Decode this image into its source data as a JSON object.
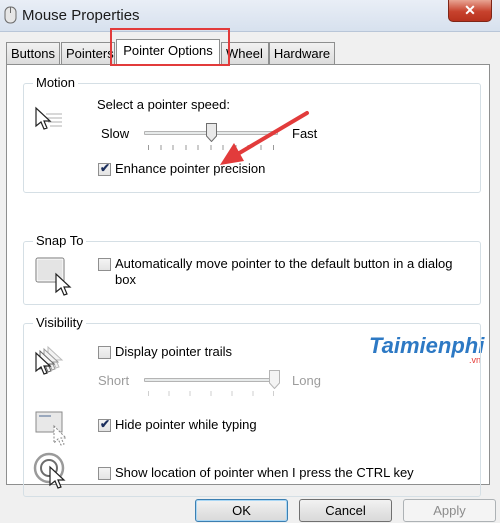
{
  "window": {
    "title": "Mouse Properties",
    "close_label": "✕"
  },
  "tabs": [
    {
      "label": "Buttons"
    },
    {
      "label": "Pointers"
    },
    {
      "label": "Pointer Options",
      "active": true
    },
    {
      "label": "Wheel"
    },
    {
      "label": "Hardware"
    }
  ],
  "motion": {
    "title": "Motion",
    "speed_label": "Select a pointer speed:",
    "slow": "Slow",
    "fast": "Fast",
    "speed_level": 0.5,
    "enhance_label": "Enhance pointer precision",
    "enhance_checked": true
  },
  "snap_to": {
    "title": "Snap To",
    "auto_move_line1": "Automatically move pointer to the default button in a dialog",
    "auto_move_line2": "box",
    "auto_move_checked": false
  },
  "visibility": {
    "title": "Visibility",
    "trails_label": "Display pointer trails",
    "trails_checked": false,
    "short": "Short",
    "long": "Long",
    "trail_level": 1.0,
    "hide_label": "Hide pointer while typing",
    "hide_checked": true,
    "ctrl_label": "Show location of pointer when I press the CTRL key",
    "ctrl_checked": false
  },
  "buttons": {
    "ok": "OK",
    "cancel": "Cancel",
    "apply": "Apply"
  },
  "watermark": {
    "brand": "Taimienphi",
    "suffix": ".vn"
  },
  "colors": {
    "highlight": "#e23b3b",
    "accent": "#3c7fb1"
  }
}
